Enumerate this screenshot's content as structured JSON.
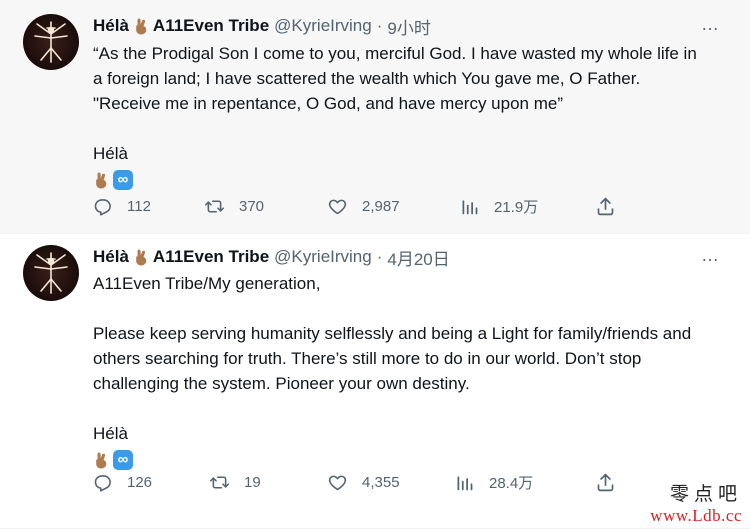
{
  "tweets": [
    {
      "name": "Hélà",
      "name_suffix": "A11Even Tribe",
      "handle": "@KyrieIrving",
      "separator": "·",
      "time": "9小时",
      "lines": [
        "“As the Prodigal Son I come to you, merciful God. I have wasted my whole life in",
        "a foreign land; I have scattered the wealth which You gave me, O Father.",
        "\"Receive me in repentance, O God, and have mercy upon me”"
      ],
      "signature": "Hélà",
      "more_icon": "…",
      "reply_count": "112",
      "retweet_count": "370",
      "like_count": "2,987",
      "view_count": "21.9万"
    },
    {
      "name": "Hélà",
      "name_suffix": "A11Even Tribe",
      "handle": "@KyrieIrving",
      "separator": "·",
      "time": "4月20日",
      "first_line": "A11Even Tribe/My generation,",
      "lines": [
        "Please keep serving humanity selflessly and being a Light for family/friends and",
        "others searching for truth. There’s still more to do in our world. Don’t stop",
        "challenging the system. Pioneer your own destiny."
      ],
      "signature": "Hélà",
      "more_icon": "…",
      "reply_count": "126",
      "retweet_count": "19",
      "like_count": "4,355",
      "view_count": "28.4万"
    }
  ],
  "icons": {
    "avatar": "avatar-figure",
    "emoji_hand": "crossed-fingers-icon",
    "emoji_infinity": "infinity-icon",
    "infinity_glyph": "∞",
    "reply": "reply-icon",
    "retweet": "retweet-icon",
    "like": "heart-icon",
    "views": "views-icon",
    "share": "share-icon"
  },
  "colors": {
    "text": "#0f1419",
    "secondary": "#536471",
    "infinity_badge": "#3b9be8",
    "hand": "#b07a4f",
    "first_background": "#f7f7f7",
    "watermark_url": "#dd2222"
  },
  "watermark": {
    "chinese": "零点吧",
    "url": "www.Ldb.cc"
  }
}
